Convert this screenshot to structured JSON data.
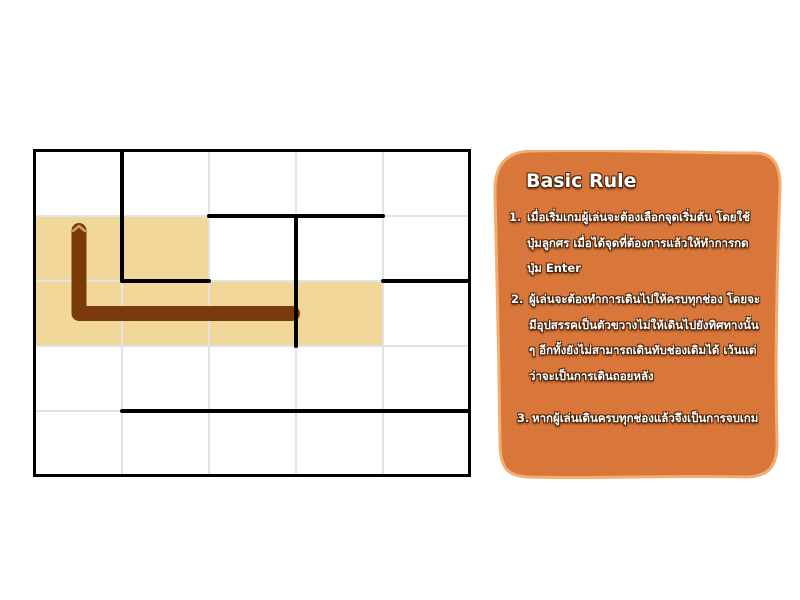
{
  "game": {
    "grid": {
      "rows": 5,
      "cols": 5,
      "visited_cells": [
        [
          1,
          0
        ],
        [
          1,
          1
        ],
        [
          2,
          0
        ],
        [
          2,
          1
        ],
        [
          2,
          2
        ],
        [
          2,
          3
        ]
      ],
      "path_cells": [
        [
          1,
          0
        ],
        [
          2,
          0
        ],
        [
          2,
          1
        ],
        [
          2,
          2
        ]
      ],
      "cursor_cell": [
        1,
        0
      ],
      "cursor_symbol": "^",
      "walls": [
        {
          "orientation": "vertical",
          "col_line": 1,
          "from_row": 0,
          "to_row": 2
        },
        {
          "orientation": "horizontal",
          "row_line": 2,
          "from_col": 1,
          "to_col": 2
        },
        {
          "orientation": "horizontal",
          "row_line": 1,
          "from_col": 2,
          "to_col": 4
        },
        {
          "orientation": "vertical",
          "col_line": 3,
          "from_row": 1,
          "to_row": 3
        },
        {
          "orientation": "horizontal",
          "row_line": 2,
          "from_col": 4,
          "to_col": 5
        },
        {
          "orientation": "horizontal",
          "row_line": 4,
          "from_col": 1,
          "to_col": 5
        }
      ]
    },
    "colors": {
      "visited_fill": "#f2d79a",
      "path": "#7a3a0b",
      "cursor": "#c8a36a",
      "wall": "#000000",
      "gridline": "#e3e3e3",
      "panel": "#d9773b",
      "panel_border": "#f2ad72",
      "text_outline": "#4a2409"
    }
  },
  "rules": {
    "title": "Basic Rule",
    "items": [
      {
        "num": "1.",
        "text": "เมื่อเริ่มเกมผู้เล่นจะต้องเลือกจุดเริ่มต้น โดยใช้ปุ่มลูกศร เมื่อได้จุดที่ต้องการแล้วให้ทำการกดปุ่ม Enter"
      },
      {
        "num": "2.",
        "text": "ผู้เล่นจะต้องทำการเดินไปให้ครบทุกช่อง โดยจะมีอุปสรรคเป็นตัวขวางไม่ให้เดินไปยังทิศทางนั้น ๆ อีกทั้งยังไม่สามารถเดินทับช่องเดิมได้ เว้นแต่ว่าจะเป็นการเดินถอยหลัง"
      },
      {
        "num": "3.",
        "text": "หากผู้เล่นเดินครบทุกช่องแล้วจึงเป็นการจบเกม"
      }
    ]
  }
}
